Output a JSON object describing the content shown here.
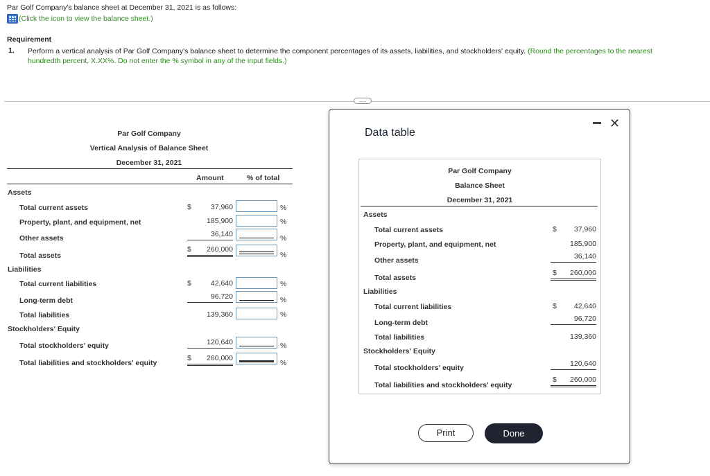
{
  "header": {
    "intro": "Par Golf Company's balance sheet at December 31, 2021 is as follows:",
    "icon_link": "(Click the icon to view the balance sheet.)",
    "icon": "table-grid-icon",
    "requirement_title": "Requirement",
    "requirement_number": "1.",
    "requirement_text": "Perform a vertical analysis of Par Golf Company's balance sheet to determine the component percentages of its assets, liabilities, and stockholders' equity.",
    "requirement_hint": "(Round the percentages to the nearest hundredth percent, X.XX%. Do not enter the % symbol in any of the input fields.)"
  },
  "divider": {
    "handle": "....."
  },
  "worksheet": {
    "company": "Par Golf Company",
    "title": "Vertical Analysis of Balance Sheet",
    "date": "December 31, 2021",
    "col_amount": "Amount",
    "col_percent": "% of total",
    "sections": {
      "assets": "Assets",
      "liabilities": "Liabilities",
      "equity": "Stockholders' Equity"
    },
    "rows": [
      {
        "label": "Total current assets",
        "dollar": "$",
        "amount": "37,960",
        "percent": "",
        "pct_symbol": "%"
      },
      {
        "label": "Property, plant, and equipment, net",
        "dollar": "",
        "amount": "185,900",
        "percent": "",
        "pct_symbol": "%"
      },
      {
        "label": "Other assets",
        "dollar": "",
        "amount": "36,140",
        "percent": "",
        "pct_symbol": "%"
      },
      {
        "label": "Total assets",
        "dollar": "$",
        "amount": "260,000",
        "percent": "",
        "pct_symbol": "%"
      },
      {
        "label": "Total current liabilities",
        "dollar": "$",
        "amount": "42,640",
        "percent": "",
        "pct_symbol": "%"
      },
      {
        "label": "Long-term debt",
        "dollar": "",
        "amount": "96,720",
        "percent": "",
        "pct_symbol": "%"
      },
      {
        "label": "Total liabilities",
        "dollar": "",
        "amount": "139,360",
        "percent": "",
        "pct_symbol": "%"
      },
      {
        "label": "Total stockholders' equity",
        "dollar": "",
        "amount": "120,640",
        "percent": "",
        "pct_symbol": "%"
      },
      {
        "label": "Total liabilities and stockholders' equity",
        "dollar": "$",
        "amount": "260,000",
        "percent": "",
        "pct_symbol": "%"
      }
    ]
  },
  "modal": {
    "title": "Data table",
    "minimize_icon": "minimize-icon",
    "close_icon": "close-icon",
    "close_glyph": "✕",
    "table": {
      "company": "Par Golf Company",
      "title": "Balance Sheet",
      "date": "December 31, 2021",
      "sections": {
        "assets": "Assets",
        "liabilities": "Liabilities",
        "equity": "Stockholders' Equity"
      },
      "rows": [
        {
          "label": "Total current assets",
          "dollar": "$",
          "amount": "37,960"
        },
        {
          "label": "Property, plant, and equipment, net",
          "dollar": "",
          "amount": "185,900"
        },
        {
          "label": "Other assets",
          "dollar": "",
          "amount": "36,140"
        },
        {
          "label": "Total assets",
          "dollar": "$",
          "amount": "260,000"
        },
        {
          "label": "Total current liabilities",
          "dollar": "$",
          "amount": "42,640"
        },
        {
          "label": "Long-term debt",
          "dollar": "",
          "amount": "96,720"
        },
        {
          "label": "Total liabilities",
          "dollar": "",
          "amount": "139,360"
        },
        {
          "label": "Total stockholders' equity",
          "dollar": "",
          "amount": "120,640"
        },
        {
          "label": "Total liabilities and stockholders' equity",
          "dollar": "$",
          "amount": "260,000"
        }
      ]
    },
    "print_label": "Print",
    "done_label": "Done"
  }
}
